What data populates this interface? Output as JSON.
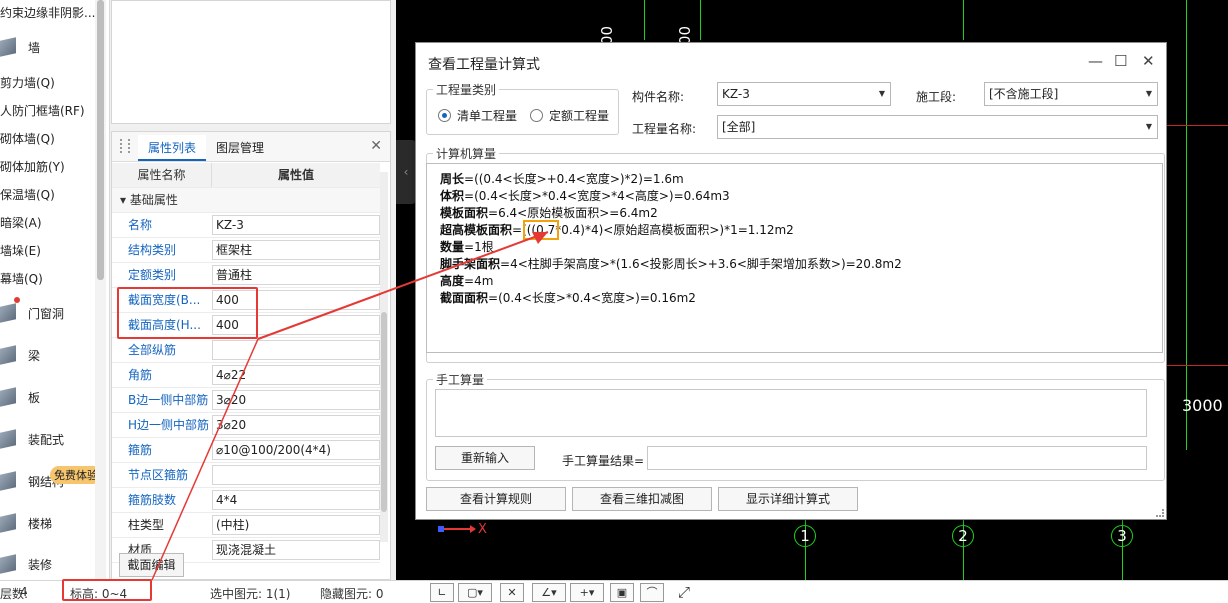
{
  "left_nav": {
    "items": [
      {
        "label": "约束边缘非阴影..."
      },
      {
        "label": "墙",
        "category": true
      },
      {
        "label": "剪力墙(Q)"
      },
      {
        "label": "人防门框墙(RF)"
      },
      {
        "label": "砌体墙(Q)"
      },
      {
        "label": "砌体加筋(Y)"
      },
      {
        "label": "保温墙(Q)"
      },
      {
        "label": "暗梁(A)"
      },
      {
        "label": "墙垛(E)"
      },
      {
        "label": "幕墙(Q)"
      }
    ],
    "categories": [
      {
        "label": "门窗洞"
      },
      {
        "label": "梁"
      },
      {
        "label": "板"
      },
      {
        "label": "装配式"
      },
      {
        "label": "钢结构"
      },
      {
        "label": "楼梯"
      },
      {
        "label": "装修"
      }
    ],
    "free_badge": "免费体验"
  },
  "props": {
    "tabs": [
      "属性列表",
      "图层管理"
    ],
    "col_name": "属性名称",
    "col_value": "属性值",
    "group_label": "基础属性",
    "rows": [
      {
        "name": "名称",
        "value": "KZ-3"
      },
      {
        "name": "结构类别",
        "value": "框架柱"
      },
      {
        "name": "定额类别",
        "value": "普通柱"
      },
      {
        "name": "截面宽度(B...",
        "value": "400"
      },
      {
        "name": "截面高度(H...",
        "value": "400"
      },
      {
        "name": "全部纵筋",
        "value": ""
      },
      {
        "name": "角筋",
        "value": "4⌀22"
      },
      {
        "name": "B边一侧中部筋",
        "value": "3⌀20"
      },
      {
        "name": "H边一侧中部筋",
        "value": "3⌀20"
      },
      {
        "name": "箍筋",
        "value": "⌀10@100/200(4*4)"
      },
      {
        "name": "节点区箍筋",
        "value": ""
      },
      {
        "name": "箍筋肢数",
        "value": "4*4"
      },
      {
        "name": "柱类型",
        "value": "(中柱)"
      },
      {
        "name": "材质",
        "value": "现浇混凝土"
      }
    ],
    "edit_button": "截面编辑"
  },
  "canvas": {
    "vertical_labels": [
      "000",
      "000"
    ],
    "dim_label": "3000",
    "axis_marks": [
      "1",
      "2",
      "3"
    ],
    "origin_label": "X"
  },
  "status": {
    "left_count_label": "层数:",
    "left_count_value": "4",
    "elevation": "标高:  0~4",
    "selected": "选中图元: 1(1)",
    "hidden": "隐藏图元: 0"
  },
  "dialog": {
    "title": "查看工程量计算式",
    "group_type": "工程量类别",
    "radio_list": "清单工程量",
    "radio_quota": "定额工程量",
    "component_label": "构件名称:",
    "component_value": "KZ-3",
    "stage_label": "施工段:",
    "stage_value": "[不含施工段]",
    "qty_name_label": "工程量名称:",
    "qty_name_value": "[全部]",
    "calc_group": "计算机算量",
    "calc_lines": [
      {
        "term": "周长",
        "expr": "=((0.4<长度>+0.4<宽度>)*2)=1.6m"
      },
      {
        "term": "体积",
        "expr": "=(0.4<长度>*0.4<宽度>*4<高度>)=0.64m3"
      },
      {
        "term": "模板面积",
        "expr": "=6.4<原始模板面积>=6.4m2"
      },
      {
        "term": "超高模板面积",
        "expr": "=(((0.7*0.4)*4)<原始超高模板面积>)*1=1.12m2"
      },
      {
        "term": "数量",
        "expr": "=1根"
      },
      {
        "term": "脚手架面积",
        "expr": "=4<柱脚手架高度>*(1.6<投影周长>+3.6<脚手架增加系数>)=20.8m2"
      },
      {
        "term": "高度",
        "expr": "=4m"
      },
      {
        "term": "截面面积",
        "expr": "=(0.4<长度>*0.4<宽度>)=0.16m2"
      }
    ],
    "manual_group": "手工算量",
    "reenter_button": "重新输入",
    "manual_result_label": "手工算量结果=",
    "view_rules_button": "查看计算规则",
    "view_3d_button": "查看三维扣减图",
    "show_detail_button": "显示详细计算式"
  },
  "colors": {
    "accent": "#1565c0",
    "grid_green": "#1fd11f",
    "grid_red": "#c62828",
    "highlight_orange": "#f0a30a",
    "annotation_red": "#e53935"
  }
}
